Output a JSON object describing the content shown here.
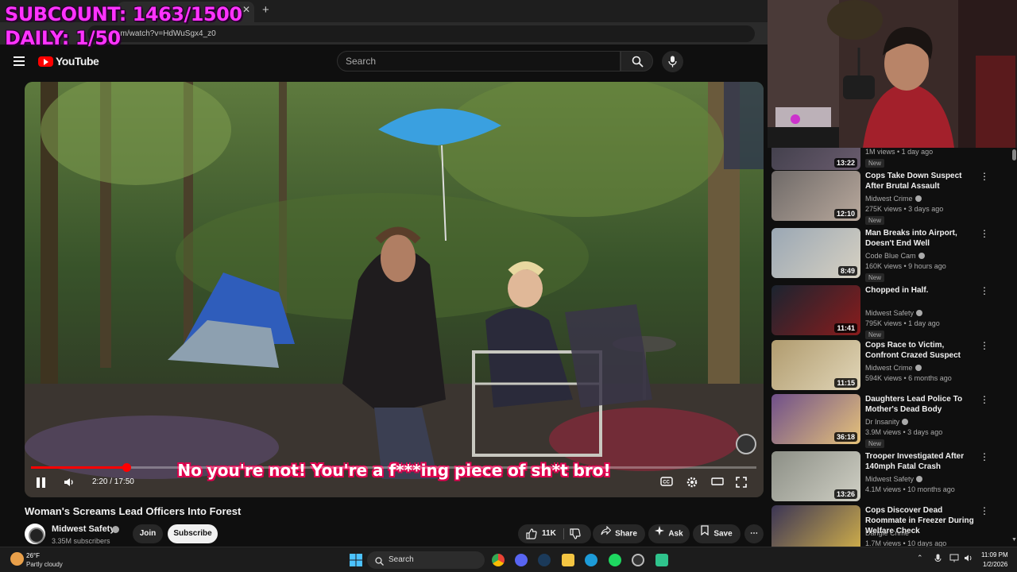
{
  "overlay": {
    "subcount": "SUBCOUNT: 1463/1500",
    "daily": "DAILY: 1/50"
  },
  "browser": {
    "url": "om/watch?v=HdWuSgx4_z0",
    "tab_audio_icon": "speaker-icon",
    "tab_close": "✕",
    "new_tab": "+"
  },
  "header": {
    "logo_text": "YouTube",
    "search_placeholder": "Search"
  },
  "player": {
    "subtitle": "No you're not! You're a f***ing piece of sh*t bro!",
    "time": "2:20 / 17:50",
    "progress_fraction": 0.131
  },
  "video": {
    "title": "Woman's Screams Lead Officers Into Forest",
    "channel": "Midwest Safety",
    "subscribers": "3.35M subscribers",
    "join_label": "Join",
    "subscribe_label": "Subscribe",
    "likes": "11K",
    "share_label": "Share",
    "ask_label": "Ask",
    "save_label": "Save"
  },
  "recommendations": [
    {
      "title": "",
      "channel": "",
      "verified": false,
      "meta": "1M views • 1 day ago",
      "badge": "New",
      "duration": "13:22",
      "thumb_colors": [
        "#3a3a45",
        "#6a5c6e"
      ]
    },
    {
      "title": "Cops Take Down Suspect After Brutal Assault",
      "channel": "Midwest Crime",
      "verified": true,
      "meta": "275K views • 3 days ago",
      "badge": "New",
      "duration": "12:10",
      "thumb_colors": [
        "#6f6a68",
        "#b8a89c"
      ]
    },
    {
      "title": "Man Breaks into Airport, Doesn't End Well",
      "channel": "Code Blue Cam",
      "verified": true,
      "meta": "160K views • 9 hours ago",
      "badge": "New",
      "duration": "8:49",
      "thumb_colors": [
        "#9aa7b4",
        "#d7d1c2"
      ]
    },
    {
      "title": "Chopped in Half.",
      "channel": "Midwest Safety",
      "verified": true,
      "meta": "795K views • 1 day ago",
      "badge": "New",
      "duration": "11:41",
      "thumb_colors": [
        "#1b2430",
        "#8a1c1c"
      ]
    },
    {
      "title": "Cops Race to Victim, Confront Crazed Suspect",
      "channel": "Midwest Crime",
      "verified": true,
      "meta": "594K views • 6 months ago",
      "badge": "",
      "duration": "11:15",
      "thumb_colors": [
        "#b09b6e",
        "#e1d6b8"
      ]
    },
    {
      "title": "Daughters Lead Police To Mother's Dead Body",
      "channel": "Dr Insanity",
      "verified": true,
      "meta": "3.9M views • 3 days ago",
      "badge": "New",
      "duration": "36:18",
      "thumb_colors": [
        "#6f4f8a",
        "#e6c37a"
      ]
    },
    {
      "title": "Trooper Investigated After 140mph Fatal Crash",
      "channel": "Midwest Safety",
      "verified": true,
      "meta": "4.1M views • 10 months ago",
      "badge": "",
      "duration": "13:26",
      "thumb_colors": [
        "#8c8f86",
        "#cfcfc4"
      ]
    },
    {
      "title": "Cops Discover Dead Roommate in Freezer During Welfare Check",
      "channel": "Dangle Crime",
      "verified": false,
      "meta": "1.7M views • 10 days ago",
      "badge": "",
      "duration": "",
      "thumb_colors": [
        "#3b3555",
        "#d4b24a"
      ]
    }
  ],
  "taskbar": {
    "temp": "26°F",
    "weather": "Partly cloudy",
    "search_label": "Search",
    "time": "11:09 PM",
    "date": "1/2/2026"
  },
  "colors": {
    "overlay": "#ff33ff",
    "subtitle_outline": "#e0004e",
    "progress": "#ff0000"
  }
}
